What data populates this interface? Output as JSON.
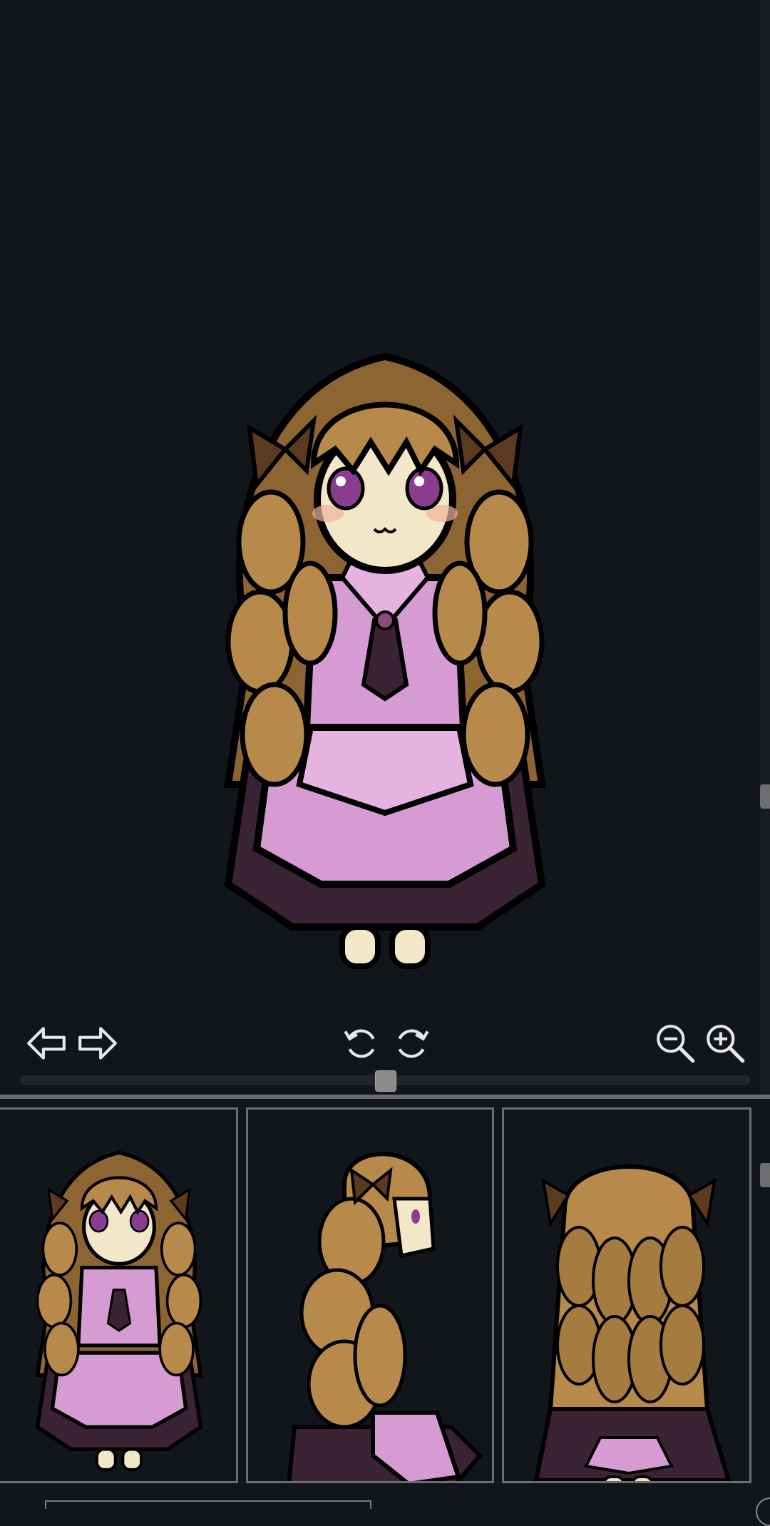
{
  "viewer": {
    "icons": {
      "prev": "arrow-left-outline-icon",
      "next": "arrow-right-outline-icon",
      "rotate_left": "rotate-left-icon",
      "rotate_right": "rotate-right-icon",
      "zoom_out": "zoom-out-icon",
      "zoom_in": "zoom-in-icon"
    },
    "rotation_slider_value": 0.5
  },
  "thumbnails": [
    {
      "view": "front"
    },
    {
      "view": "side"
    },
    {
      "view": "back"
    }
  ],
  "colors": {
    "background": "#12151a",
    "hair": "#b78a4c",
    "dress_pink": "#d79bd3",
    "dress_dark": "#3a2333",
    "ribbon": "#5b3a1f",
    "eyes": "#8a3d8f",
    "skin": "#f2e7c9"
  }
}
